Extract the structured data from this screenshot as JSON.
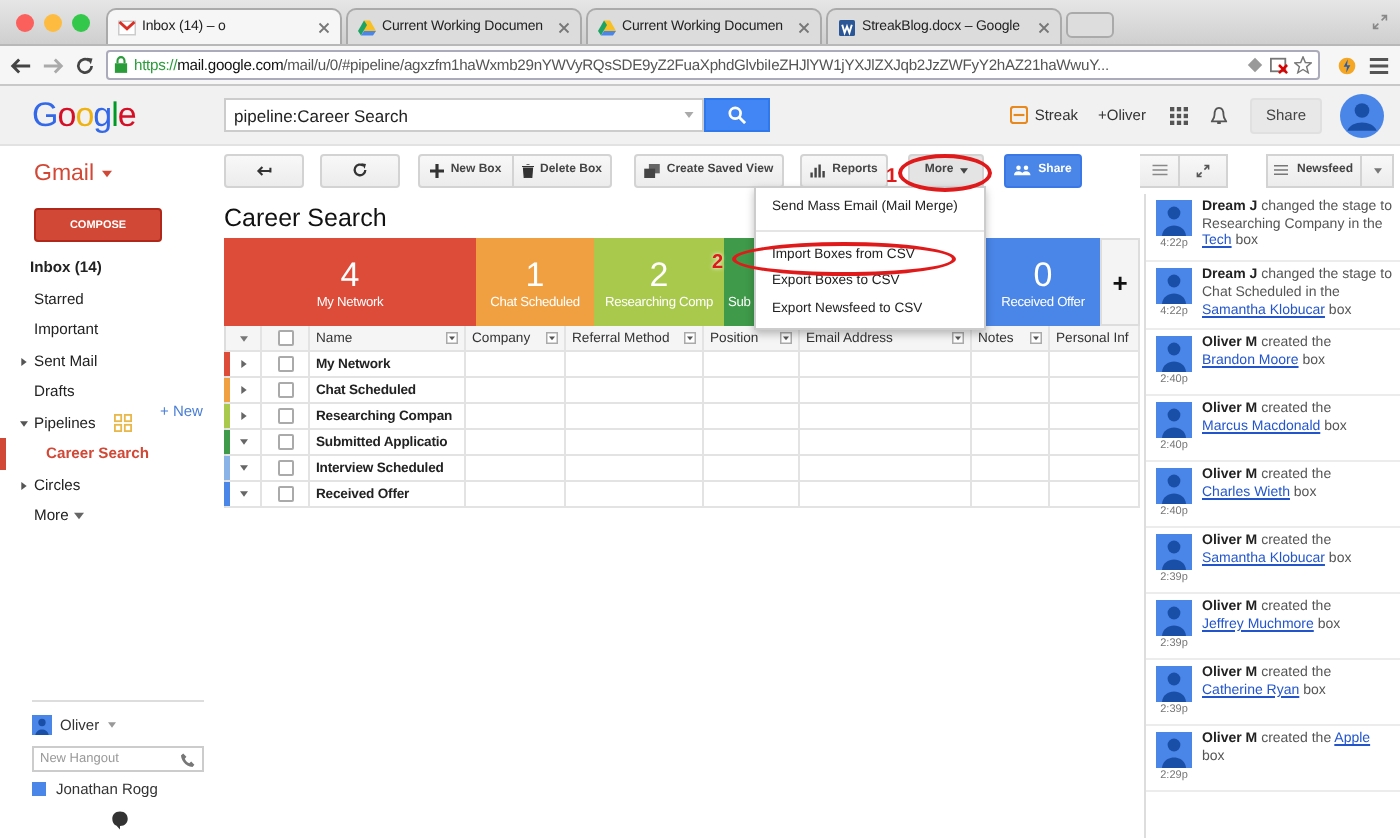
{
  "browser": {
    "tabs": [
      {
        "title": "Inbox (14) – o",
        "kind": "mail",
        "selected": true
      },
      {
        "title": "Current Working Documen",
        "kind": "drive",
        "selected": false
      },
      {
        "title": "Current Working Documen",
        "kind": "drive",
        "selected": false
      },
      {
        "title": "StreakBlog.docx – Google",
        "kind": "doc",
        "selected": false
      }
    ],
    "url": {
      "scheme": "https://",
      "host": "mail.google.com",
      "path": "/mail/u/0/#pipeline/agxzfm1haWxmb29nYWVyRQsSDE9yZ2FuaXphdGlvbiIeZHJlYW1jYXJlZXJqb2JzZWFyY2hAZ21haWwuY..."
    }
  },
  "header": {
    "logo": "Google",
    "search": "pipeline:Career Search",
    "streak": "Streak",
    "plus_user": "+Oliver",
    "share": "Share"
  },
  "sidebar": {
    "title": "Gmail",
    "compose": "COMPOSE",
    "items": [
      {
        "label": "Inbox (14)",
        "kind": "plain",
        "unread": true,
        "selected": false
      },
      {
        "label": "Starred",
        "kind": "plain",
        "unread": false,
        "selected": false
      },
      {
        "label": "Important",
        "kind": "plain",
        "unread": false,
        "selected": false
      },
      {
        "label": "Sent Mail",
        "kind": "folder",
        "expanded": false,
        "unread": false,
        "selected": false
      },
      {
        "label": "Drafts",
        "kind": "plain",
        "unread": false,
        "selected": false
      },
      {
        "label": "Pipelines",
        "kind": "folder",
        "expanded": true,
        "unread": false,
        "selected": false,
        "action": "+ New",
        "children": [
          {
            "label": "Career Search",
            "selected": true
          }
        ]
      },
      {
        "label": "Circles",
        "kind": "folder",
        "expanded": false,
        "unread": false,
        "selected": false
      },
      {
        "label": "More",
        "kind": "more",
        "unread": false,
        "selected": false
      }
    ]
  },
  "hangouts": {
    "user": "Oliver",
    "placeholder": "New Hangout",
    "contacts": [
      "Jonathan Rogg"
    ]
  },
  "toolbar": {
    "buttons": [
      {
        "kind": "back"
      },
      {
        "kind": "refresh"
      },
      {
        "kind": "new",
        "label": "New Box"
      },
      {
        "kind": "delete",
        "label": "Delete Box"
      },
      {
        "kind": "saved_view",
        "label": "Create Saved View"
      },
      {
        "kind": "reports",
        "label": "Reports"
      },
      {
        "kind": "more",
        "label": "More"
      },
      {
        "kind": "share",
        "label": "Share"
      }
    ]
  },
  "pipeline": {
    "title": "Career Search",
    "add": "+",
    "stages": [
      {
        "count": "4",
        "name": "My Network",
        "color": "#dd4b39"
      },
      {
        "count": "1",
        "name": "Chat Scheduled",
        "color": "#f0a040"
      },
      {
        "count": "2",
        "name": "Researching Comp",
        "color": "#a9c94c"
      },
      {
        "name": "Sub",
        "color": "#3f9a4a"
      },
      {
        "count": "0",
        "name": "Received Offer",
        "color": "#4a86e8"
      }
    ]
  },
  "table": {
    "all_checked": false,
    "columns": [
      {
        "label": "Name",
        "menu": true
      },
      {
        "label": "Company",
        "menu": true
      },
      {
        "label": "Referral Method",
        "menu": true
      },
      {
        "label": "Position",
        "menu": true
      },
      {
        "label": "Email Address",
        "menu": true
      },
      {
        "label": "Notes",
        "menu": true
      },
      {
        "label": "Personal Inf",
        "menu": false
      }
    ],
    "rows": [
      {
        "name": "My Network",
        "color": "#dd4b39",
        "expanded": false,
        "checked": false
      },
      {
        "name": "Chat Scheduled",
        "color": "#f0a040",
        "expanded": false,
        "checked": false
      },
      {
        "name": "Researching Compan",
        "color": "#a9c94c",
        "expanded": false,
        "checked": false
      },
      {
        "name": "Submitted Applicatio",
        "color": "#3f9a4a",
        "expanded": true,
        "checked": false
      },
      {
        "name": "Interview Scheduled",
        "color": "#8ab4e8",
        "expanded": true,
        "checked": false
      },
      {
        "name": "Received Offer",
        "color": "#4a86e8",
        "expanded": true,
        "checked": false
      }
    ]
  },
  "menu": {
    "sections": [
      [
        "Send Mass Email (Mail Merge)"
      ],
      [
        "Import Boxes from CSV",
        "Export Boxes to CSV",
        "Export Newsfeed to CSV"
      ]
    ]
  },
  "annotations": [
    {
      "number": "1"
    },
    {
      "number": "2"
    }
  ],
  "newsfeed": {
    "label": "Newsfeed",
    "items": [
      {
        "actor": "Dream J",
        "action": "changed the stage to Researching Company in the",
        "link": "Tech",
        "after": "box",
        "time": "4:22p"
      },
      {
        "actor": "Dream J",
        "action": "changed the stage to Chat Scheduled in the",
        "link": "Samantha Klobucar",
        "after": "box",
        "time": "4:22p"
      },
      {
        "actor": "Oliver M",
        "action": "created the",
        "link": "Brandon Moore",
        "after": "box",
        "time": "2:40p"
      },
      {
        "actor": "Oliver M",
        "action": "created the",
        "link": "Marcus Macdonald",
        "after": "box",
        "time": "2:40p"
      },
      {
        "actor": "Oliver M",
        "action": "created the",
        "link": "Charles Wieth",
        "after": "box",
        "time": "2:40p"
      },
      {
        "actor": "Oliver M",
        "action": "created the",
        "link": "Samantha Klobucar",
        "after": "box",
        "time": "2:39p"
      },
      {
        "actor": "Oliver M",
        "action": "created the",
        "link": "Jeffrey Muchmore",
        "after": "box",
        "time": "2:39p"
      },
      {
        "actor": "Oliver M",
        "action": "created the",
        "link": "Catherine Ryan",
        "after": "box",
        "time": "2:39p"
      },
      {
        "actor": "Oliver M",
        "action": "created the",
        "link": "Apple",
        "after": "box",
        "time": "2:29p"
      }
    ]
  }
}
